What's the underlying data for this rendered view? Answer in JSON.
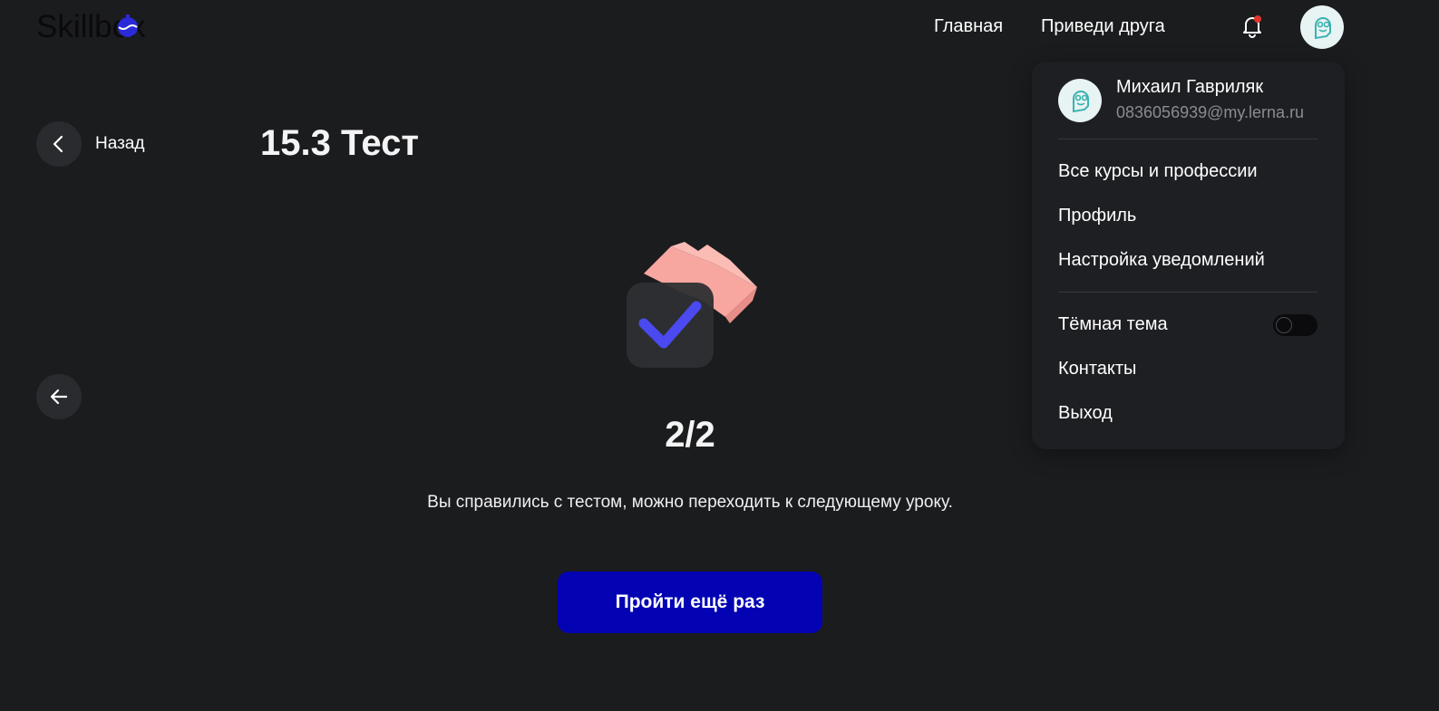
{
  "header": {
    "logo_text": "Skillbox",
    "nav": [
      {
        "label": "Главная"
      },
      {
        "label": "Приведи друга"
      }
    ],
    "notification_dot_color": "#e0362c"
  },
  "lesson": {
    "back_label": "Назад",
    "title": "15.3 Тест",
    "score": "2/2",
    "message": "Вы справились с тестом, можно переходить к следующему уроку.",
    "retry_label": "Пройти ещё раз"
  },
  "user_menu": {
    "name": "Михаил Гавриляк",
    "email": "0836056939@my.lerna.ru",
    "items": [
      {
        "label": "Все курсы и профессии"
      },
      {
        "label": "Профиль"
      },
      {
        "label": "Настройка уведомлений"
      }
    ],
    "dark_theme_label": "Тёмная тема",
    "dark_theme_enabled": false,
    "bottom_items": [
      {
        "label": "Контакты"
      },
      {
        "label": "Выход"
      }
    ]
  },
  "colors": {
    "background": "#1b1c1e",
    "accent_button": "#0303b3",
    "check_color": "#4a4af0",
    "card_pink": "#f7a6a0"
  }
}
